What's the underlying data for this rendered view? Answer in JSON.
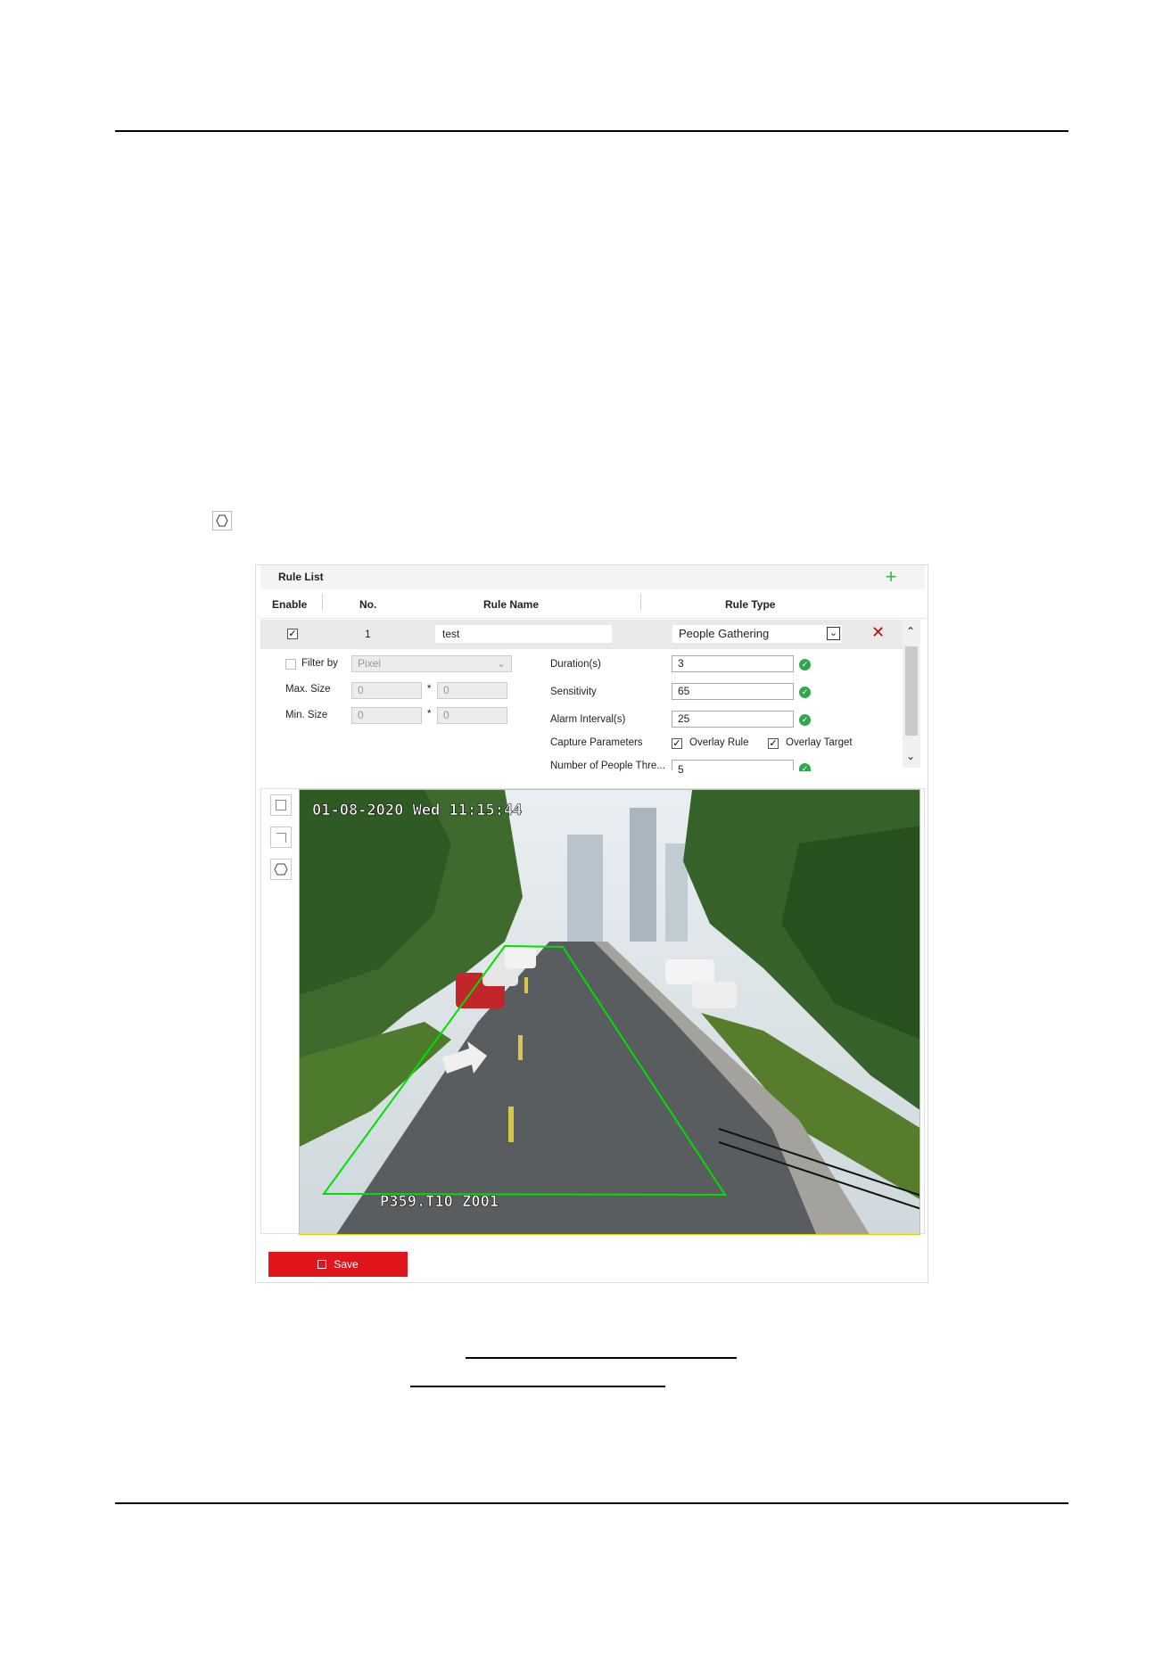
{
  "rule_list": {
    "title": "Rule List",
    "columns": {
      "enable": "Enable",
      "no": "No.",
      "rule_name": "Rule Name",
      "rule_type": "Rule Type"
    },
    "row": {
      "enabled": true,
      "no": "1",
      "name": "test",
      "type": "People Gathering"
    }
  },
  "params": {
    "filter_by_label": "Filter by",
    "filter_by_value": "Pixel",
    "max_size_label": "Max. Size",
    "min_size_label": "Min. Size",
    "max_w": "0",
    "max_h": "0",
    "min_w": "0",
    "min_h": "0",
    "times": "*",
    "duration_label": "Duration(s)",
    "duration_value": "3",
    "sensitivity_label": "Sensitivity",
    "sensitivity_value": "65",
    "alarm_interval_label": "Alarm Interval(s)",
    "alarm_interval_value": "25",
    "capture_label": "Capture Parameters",
    "overlay_rule_label": "Overlay Rule",
    "overlay_target_label": "Overlay Target",
    "people_threshold_label": "Number of People Thre...",
    "people_threshold_value": "5"
  },
  "video": {
    "timestamp": "01-08-2020 Wed 11:15:44",
    "osd_bottom": "P359.T10   Z001"
  },
  "save_label": "Save",
  "colors": {
    "accent_red": "#e0161c",
    "region_green": "#00e000",
    "ok_green": "#2ea84a"
  }
}
